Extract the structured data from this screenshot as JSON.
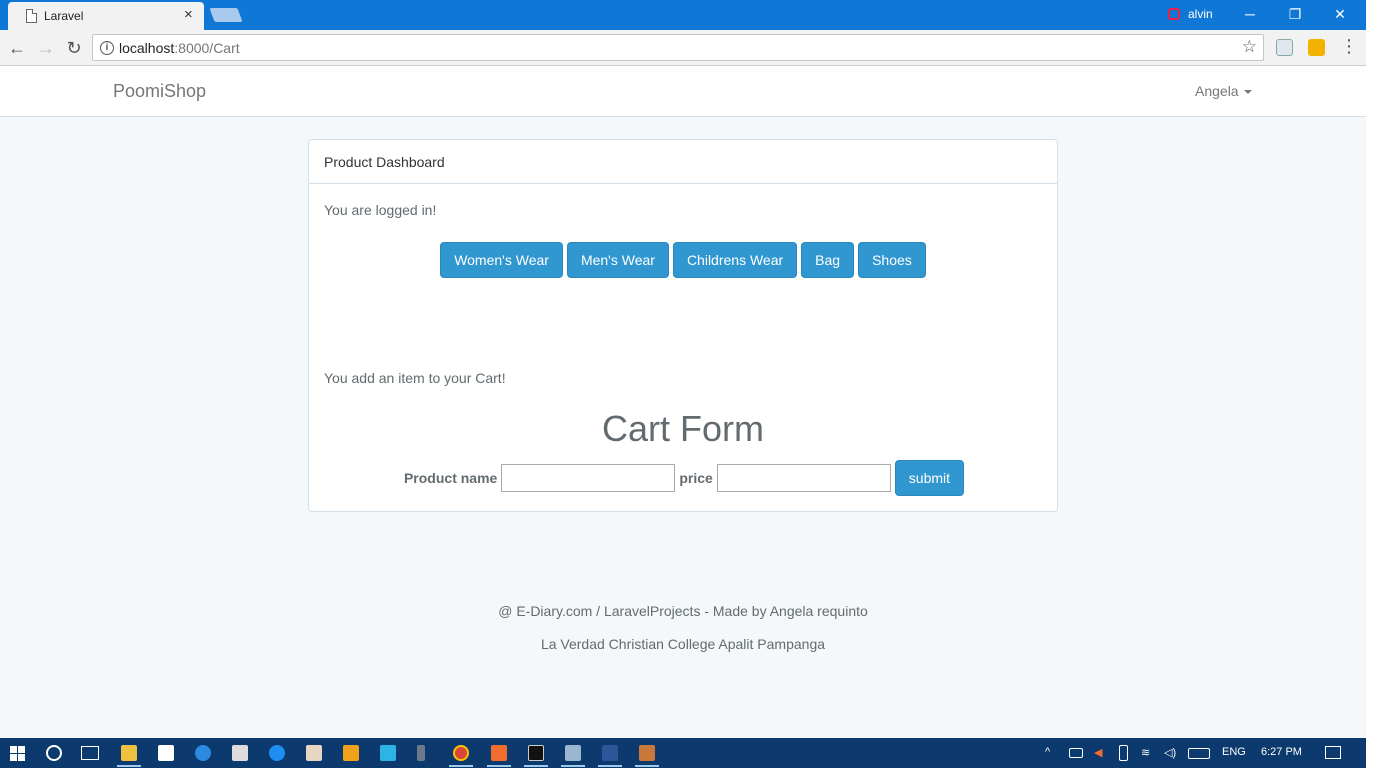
{
  "browser": {
    "tab_title": "Laravel",
    "tab_close": "×",
    "profile_name": "alvin",
    "url_host": "localhost",
    "url_path": ":8000/Cart",
    "controls": {
      "minimize": "─",
      "restore": "❐",
      "close": "✕"
    },
    "nav": {
      "back": "←",
      "forward": "→",
      "reload": "↻"
    }
  },
  "navbar": {
    "brand": "PoomiShop",
    "user": "Angela"
  },
  "panel": {
    "heading": "Product Dashboard",
    "status": "You are logged in!",
    "categories": [
      "Women's Wear",
      "Men's Wear",
      "Childrens Wear",
      "Bag",
      "Shoes"
    ],
    "cart_message": "You add an item to your Cart!",
    "cart_title": "Cart Form",
    "form": {
      "product_label": "Product name",
      "product_value": "",
      "price_label": "price",
      "price_value": "",
      "submit_label": "submit"
    }
  },
  "footer": {
    "line1": "@ E-Diary.com / LaravelProjects - Made by Angela requinto",
    "line2": "La Verdad Christian College Apalit Pampanga"
  },
  "taskbar": {
    "language": "ENG",
    "time": "6:27 PM"
  },
  "colors": {
    "accent": "#3097d1",
    "chrome_titlebar": "#0f78d6",
    "page_bg": "#f5f8fa",
    "taskbar": "#0c3a6e"
  }
}
